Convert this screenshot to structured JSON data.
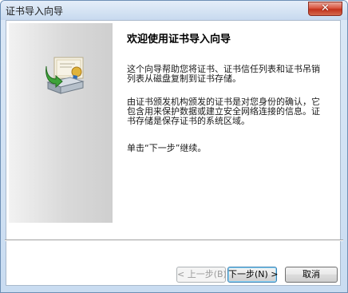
{
  "window": {
    "title": "证书导入向导"
  },
  "wizard": {
    "heading": "欢迎使用证书导入向导",
    "paragraph1": "这个向导帮助您将证书、证书信任列表和证书吊销列表从磁盘复制到证书存储。",
    "paragraph2": "由证书颁发机构颁发的证书是对您身份的确认，它包含用来保护数据或建立安全网络连接的信息。证书存储是保存证书的系统区域。",
    "paragraph3": "单击“下一步”继续。"
  },
  "buttons": {
    "back": "< 上一步(B)",
    "next": "下一步(N) >",
    "cancel": "取消"
  },
  "icons": {
    "close": "close-icon",
    "wizard": "certificate-import-icon"
  }
}
